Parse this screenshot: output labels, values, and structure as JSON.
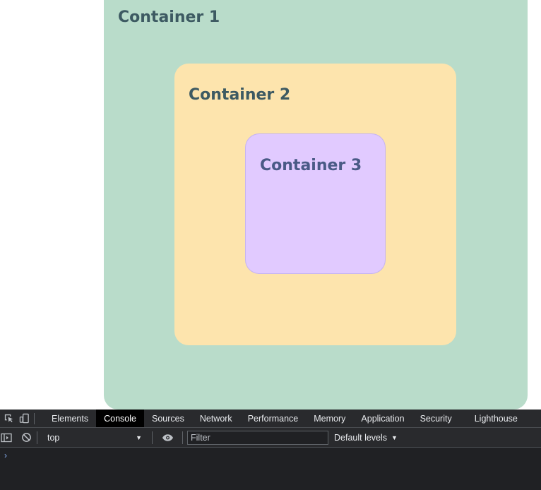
{
  "containers": [
    {
      "title": "Container 1",
      "bg": "#b9dcca",
      "title_color": "#3d5a62"
    },
    {
      "title": "Container 2",
      "bg": "#fde4ad",
      "title_color": "#3d5a62"
    },
    {
      "title": "Container 3",
      "bg": "#e1caff",
      "title_color": "#4a5a86"
    }
  ],
  "devtools": {
    "tabs": [
      "Elements",
      "Console",
      "Sources",
      "Network",
      "Performance",
      "Memory",
      "Application",
      "Security",
      "Lighthouse"
    ],
    "active_tab": "Console",
    "context": "top",
    "filter_placeholder": "Filter",
    "levels": "Default levels",
    "prompt": "›",
    "icons": {
      "inspect": "inspect-element-icon",
      "device": "device-toolbar-icon",
      "sidebar": "console-sidebar-icon",
      "clear": "clear-console-icon",
      "eye": "live-expression-eye-icon",
      "dropdown": "chevron-down-icon"
    },
    "colors": {
      "panel": "#202124",
      "toolbar": "#292a2d",
      "active_tab": "#000000"
    }
  }
}
